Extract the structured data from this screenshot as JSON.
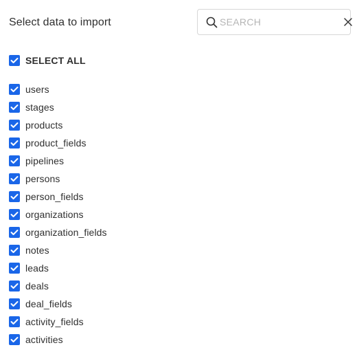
{
  "header": {
    "title": "Select data to import"
  },
  "search": {
    "placeholder": "SEARCH",
    "value": "",
    "icon": "search-icon",
    "clear_icon": "close-icon"
  },
  "select_all": {
    "label": "SELECT ALL",
    "checked": true
  },
  "items": [
    {
      "label": "users",
      "checked": true
    },
    {
      "label": "stages",
      "checked": true
    },
    {
      "label": "products",
      "checked": true
    },
    {
      "label": "product_fields",
      "checked": true
    },
    {
      "label": "pipelines",
      "checked": true
    },
    {
      "label": "persons",
      "checked": true
    },
    {
      "label": "person_fields",
      "checked": true
    },
    {
      "label": "organizations",
      "checked": true
    },
    {
      "label": "organization_fields",
      "checked": true
    },
    {
      "label": "notes",
      "checked": true
    },
    {
      "label": "leads",
      "checked": true
    },
    {
      "label": "deals",
      "checked": true
    },
    {
      "label": "deal_fields",
      "checked": true
    },
    {
      "label": "activity_fields",
      "checked": true
    },
    {
      "label": "activities",
      "checked": true
    }
  ],
  "colors": {
    "checkbox_accent": "#1a66e8",
    "text": "#2f2f2f",
    "placeholder": "#b5b5b5",
    "border": "#d6d6d6"
  }
}
